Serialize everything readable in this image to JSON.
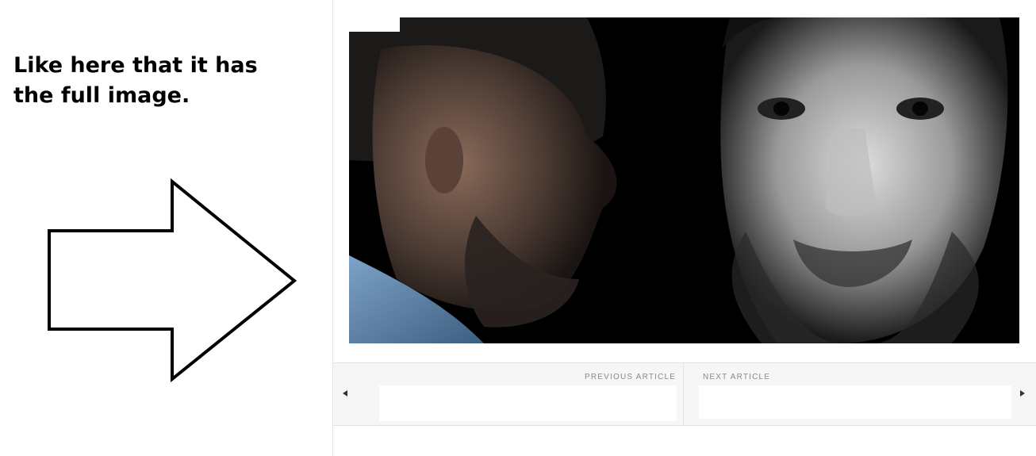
{
  "annotation": {
    "text": "Like here that it has the full image.",
    "arrow_icon": "right-arrow-icon"
  },
  "article": {
    "hero_image": "portrait-image",
    "nav": {
      "previous_label": "PREVIOUS ARTICLE",
      "next_label": "NEXT ARTICLE",
      "left_icon": "caret-left-icon",
      "right_icon": "caret-right-icon"
    }
  },
  "colors": {
    "nav_background": "#f6f6f6",
    "nav_label": "#8a8a8a",
    "hero_background": "#000000"
  }
}
